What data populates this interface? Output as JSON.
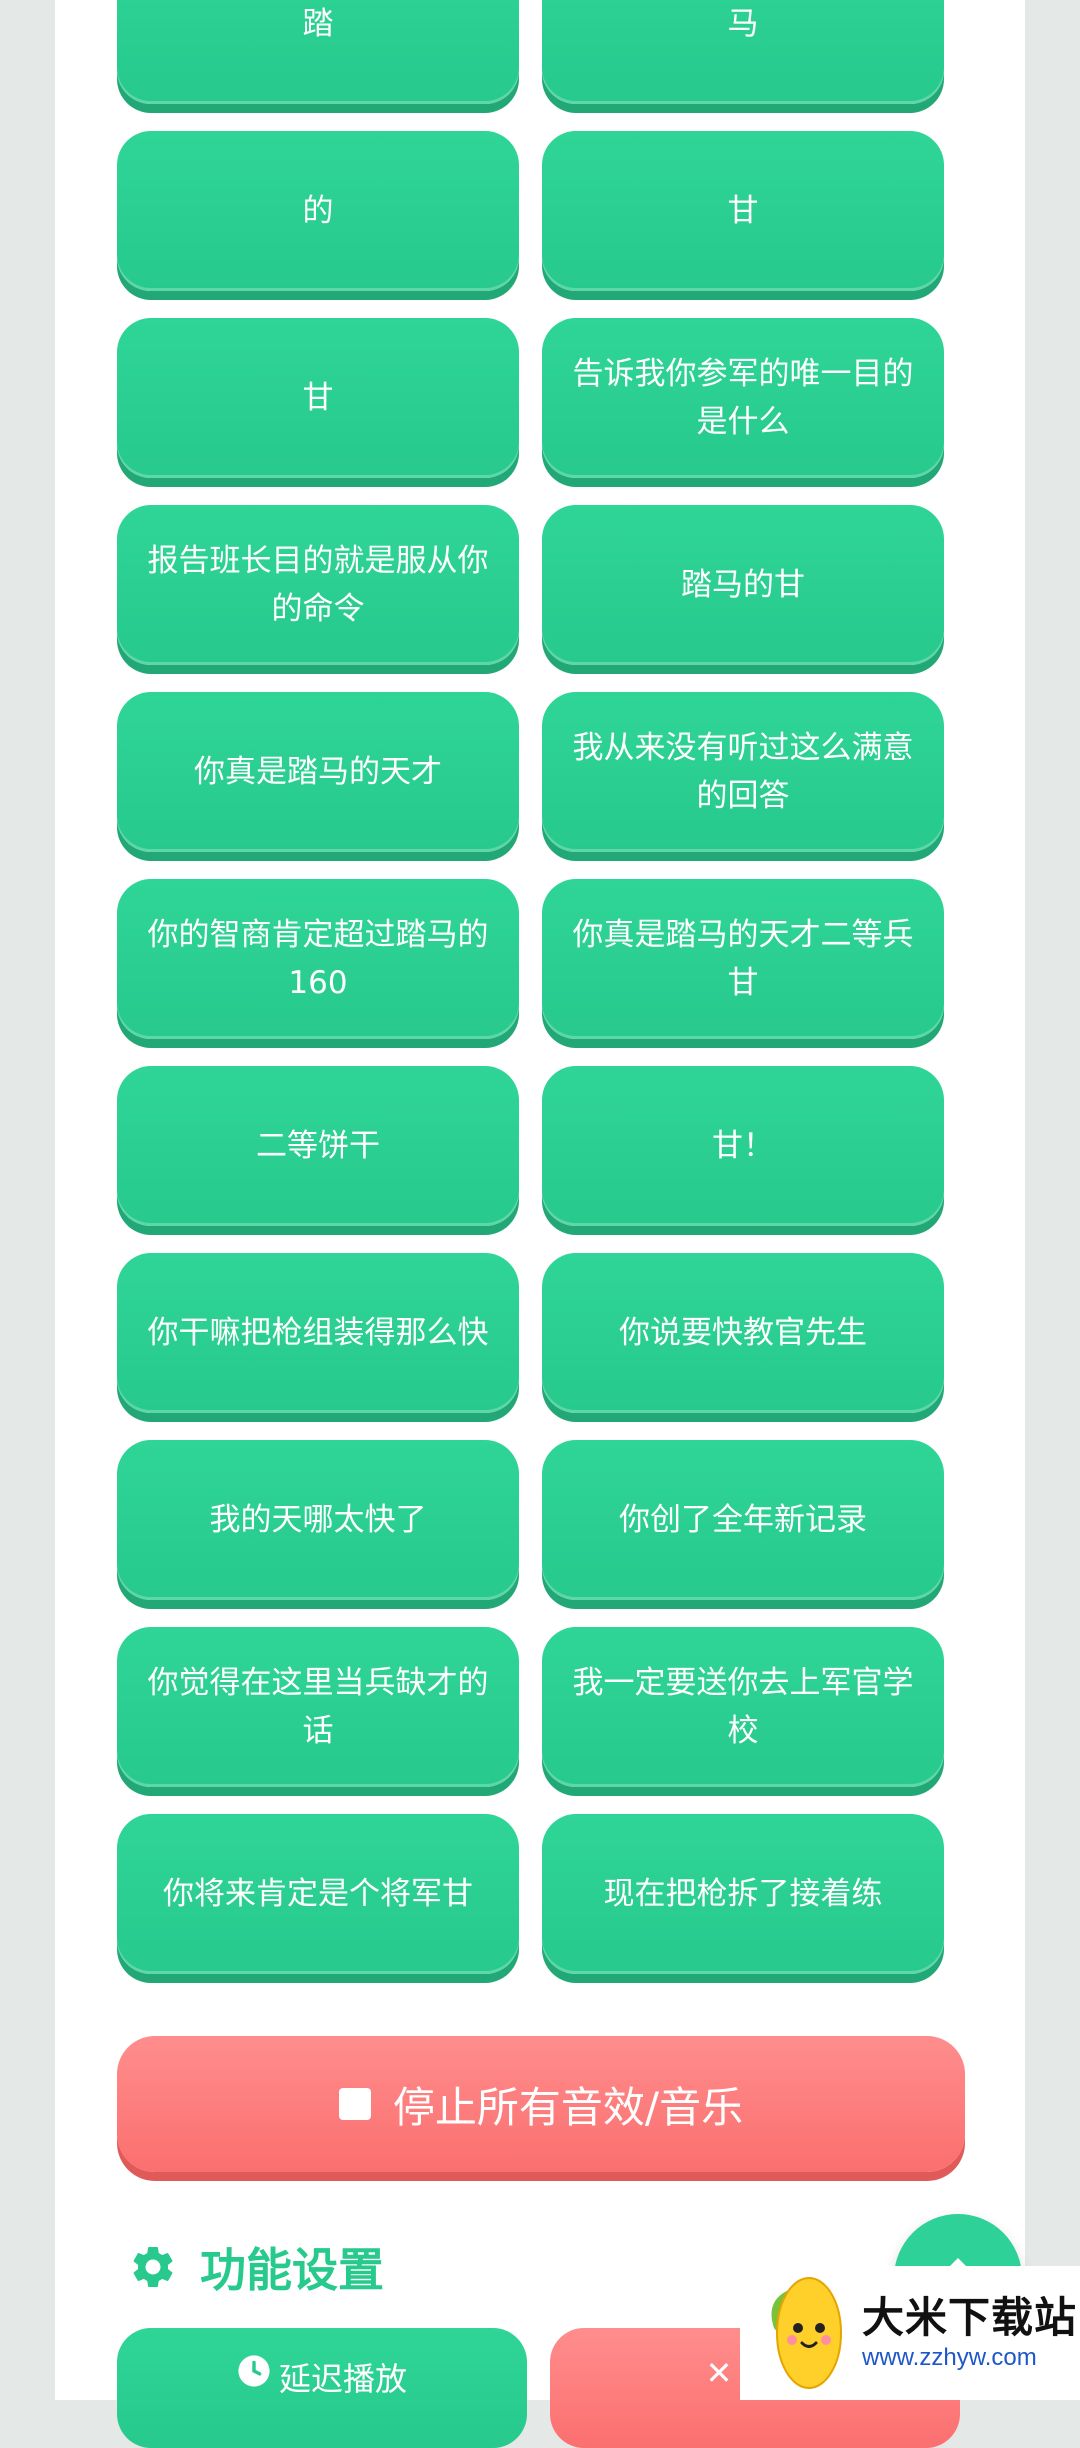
{
  "sound_buttons": [
    "踏",
    "马",
    "的",
    "甘",
    "甘",
    "告诉我你参军的唯一目的是什么",
    "报告班长目的就是服从你的命令",
    "踏马的甘",
    "你真是踏马的天才",
    "我从来没有听过这么满意的回答",
    "你的智商肯定超过踏马的160",
    "你真是踏马的天才二等兵甘",
    "二等饼干",
    "甘！",
    "你干嘛把枪组装得那么快",
    "你说要快教官先生",
    "我的天哪太快了",
    "你创了全年新记录",
    "你觉得在这里当兵缺才的话",
    "我一定要送你去上军官学校",
    "你将来肯定是个将军甘",
    "现在把枪拆了接着练"
  ],
  "stop_button": {
    "label": "停止所有音效/音乐"
  },
  "settings": {
    "title": "功能设置",
    "delay_label": "延迟播放",
    "cancel_label": "取消"
  },
  "watermark": {
    "title": "大米下载站",
    "url": "www.zzhyw.com"
  },
  "colors": {
    "green": "#27c98d",
    "red": "#fb6f6f",
    "background": "#e4e9e7"
  }
}
